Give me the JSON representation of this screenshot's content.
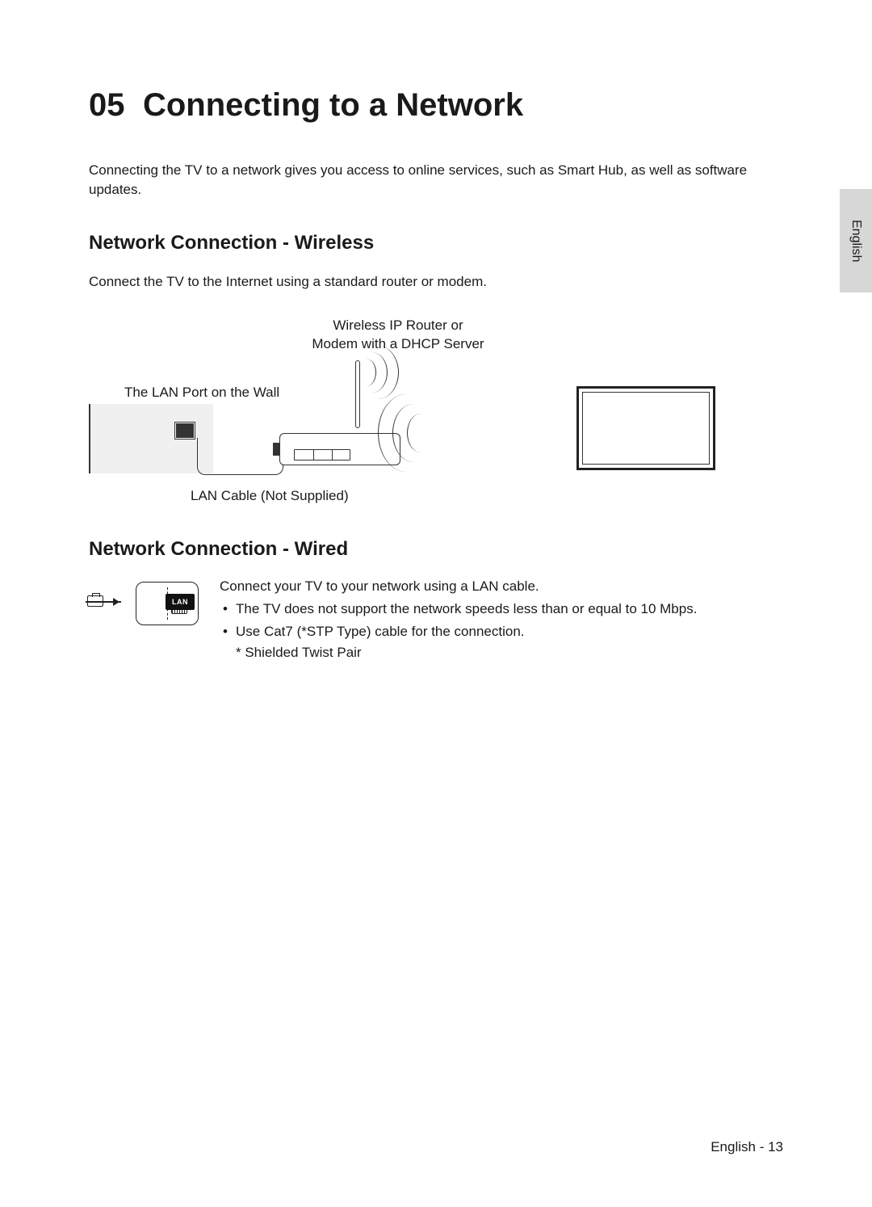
{
  "section": {
    "number": "05",
    "title": "Connecting to a Network",
    "intro": "Connecting the TV to a network gives you access to online services, such as Smart Hub, as well as software updates."
  },
  "side_tab": "English",
  "wireless": {
    "heading": "Network Connection - Wireless",
    "intro": "Connect the TV to the Internet using a standard router or modem.",
    "diagram": {
      "router_label_line1": "Wireless IP Router or",
      "router_label_line2": "Modem with a DHCP Server",
      "lan_wall_label": "The LAN Port on the Wall",
      "cable_label": "LAN Cable (Not Supplied)"
    }
  },
  "wired": {
    "heading": "Network Connection - Wired",
    "icon_label": "LAN",
    "intro": "Connect your TV to your network using a LAN cable.",
    "bullets": [
      "The TV does not support the network speeds less than or equal to 10 Mbps.",
      "Use Cat7 (*STP Type) cable for the connection."
    ],
    "footnote": "* Shielded Twist Pair"
  },
  "footer": {
    "text": "English - 13"
  }
}
